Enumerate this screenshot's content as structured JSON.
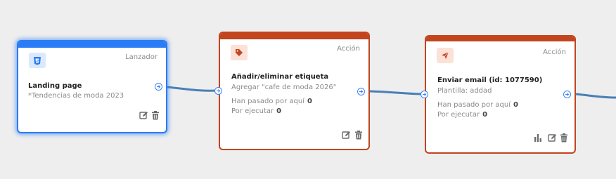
{
  "colors": {
    "launcher_accent": "#2a7cf6",
    "action_accent": "#c2451e",
    "connector": "#4a7fb5",
    "canvas": "#eeeeee"
  },
  "nodes": [
    {
      "kind": "Lanzador",
      "icon": "html5-icon",
      "title": "Landing page",
      "subtitle": "*Tendencias de moda 2023",
      "tools": [
        "edit-icon",
        "trash-icon"
      ]
    },
    {
      "kind": "Acción",
      "icon": "tag-icon",
      "title": "Añadir/eliminar etiqueta",
      "subtitle": "Agregar \"cafe de moda 2026\"",
      "passed_label": "Han pasado por aquí",
      "passed_value": "0",
      "pending_label": "Por ejecutar",
      "pending_value": "0",
      "tools": [
        "edit-icon",
        "trash-icon"
      ]
    },
    {
      "kind": "Acción",
      "icon": "send-icon",
      "title": "Enviar email (id: 1077590)",
      "subtitle": "Plantilla: addad",
      "passed_label": "Han pasado por aquí",
      "passed_value": "0",
      "pending_label": "Por ejecutar",
      "pending_value": "0",
      "tools": [
        "stats-icon",
        "edit-icon",
        "trash-icon"
      ]
    }
  ]
}
